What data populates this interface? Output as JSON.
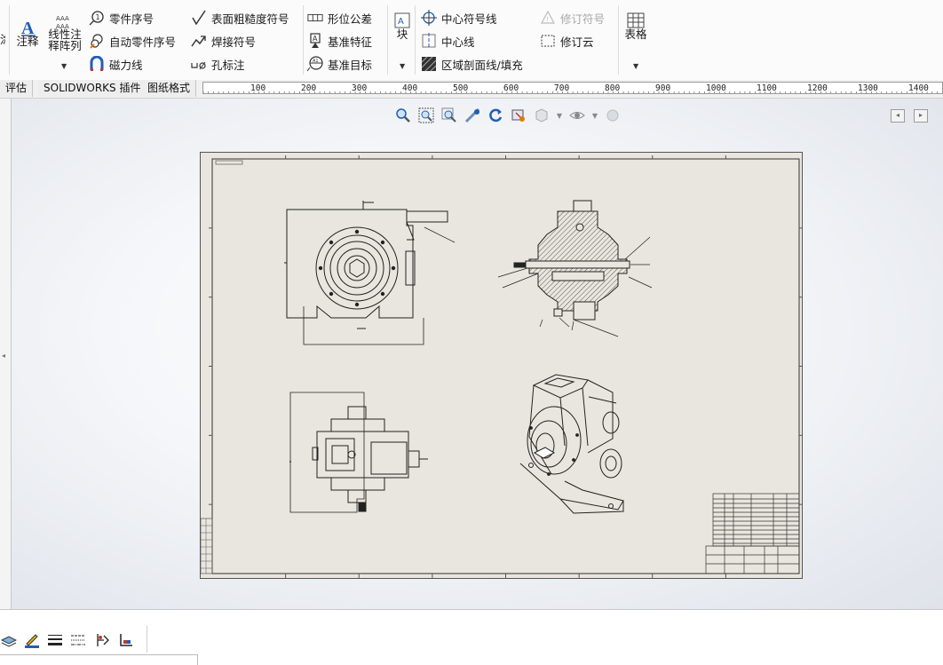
{
  "ribbon": {
    "edge_label": "涂",
    "annotation_label": "注释",
    "linear_pattern_line1": "线性注",
    "linear_pattern_line2": "释阵列",
    "balloon": "零件序号",
    "auto_balloon": "自动零件序号",
    "magnetic_line": "磁力线",
    "surface_finish": "表面粗糙度符号",
    "weld_symbol": "焊接符号",
    "hole_callout": "孔标注",
    "gtol": "形位公差",
    "datum_feature": "基准特征",
    "datum_target": "基准目标",
    "block": "块",
    "center_mark": "中心符号线",
    "centerline": "中心线",
    "area_hatch": "区域剖面线/填充",
    "revision_symbol": "修订符号",
    "revision_cloud": "修订云",
    "table": "表格"
  },
  "tabs": [
    "评估",
    "SOLIDWORKS 插件",
    "图纸格式"
  ],
  "ruler": {
    "labels": [
      "100",
      "200",
      "300",
      "400",
      "500",
      "600",
      "700",
      "800",
      "900",
      "1000",
      "1100",
      "1200",
      "1300",
      "1400"
    ]
  },
  "colors": {
    "accent_blue": "#1f5fb4",
    "sheet_bg": "#e8e6de",
    "ribbon_bg": "#fbfbfb"
  },
  "icons": {
    "view_toolbar": [
      "zoom-to-fit-icon",
      "zoom-area-icon",
      "zoom-in-out-icon",
      "select-icon",
      "rotate-icon",
      "section-view-icon",
      "display-style-icon",
      "hide-show-icon",
      "appearance-icon"
    ],
    "bottom_toolbar": [
      "layer-icon",
      "line-color-icon",
      "line-thickness-icon",
      "line-style-icon",
      "hide-edge-icon",
      "color-display-icon"
    ]
  }
}
